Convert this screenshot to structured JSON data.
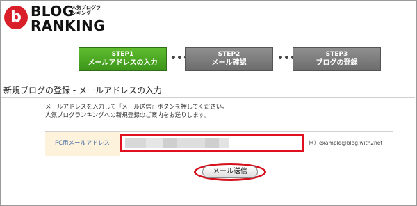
{
  "logo": {
    "mark_glyph": "b",
    "word1": "BLOG",
    "sub": "人気ブログランキング",
    "word2": "RANKING"
  },
  "steps": [
    {
      "num": "STEP1",
      "label": "メールアドレスの入力",
      "state": "active"
    },
    {
      "num": "STEP2",
      "label": "メール確認",
      "state": "inactive"
    },
    {
      "num": "STEP3",
      "label": "ブログの登録",
      "state": "inactive"
    }
  ],
  "separator": "•••",
  "page_title": "新規ブログの登録 - メールアドレスの入力",
  "instructions": [
    "メールアドレスを入力して『メール送信』ボタンを押してください。",
    "人気ブログランキングへの新規登録のご案内をお送りします。"
  ],
  "form": {
    "label": "PC用メールアドレス",
    "email_value": "",
    "example": "例）example@blog.with2net"
  },
  "submit_label": "メール送信",
  "colors": {
    "step_active": "#4aa824",
    "step_inactive": "#7d7d7d",
    "highlight": "#e0101e",
    "label_bg": "#fdf3dd"
  }
}
